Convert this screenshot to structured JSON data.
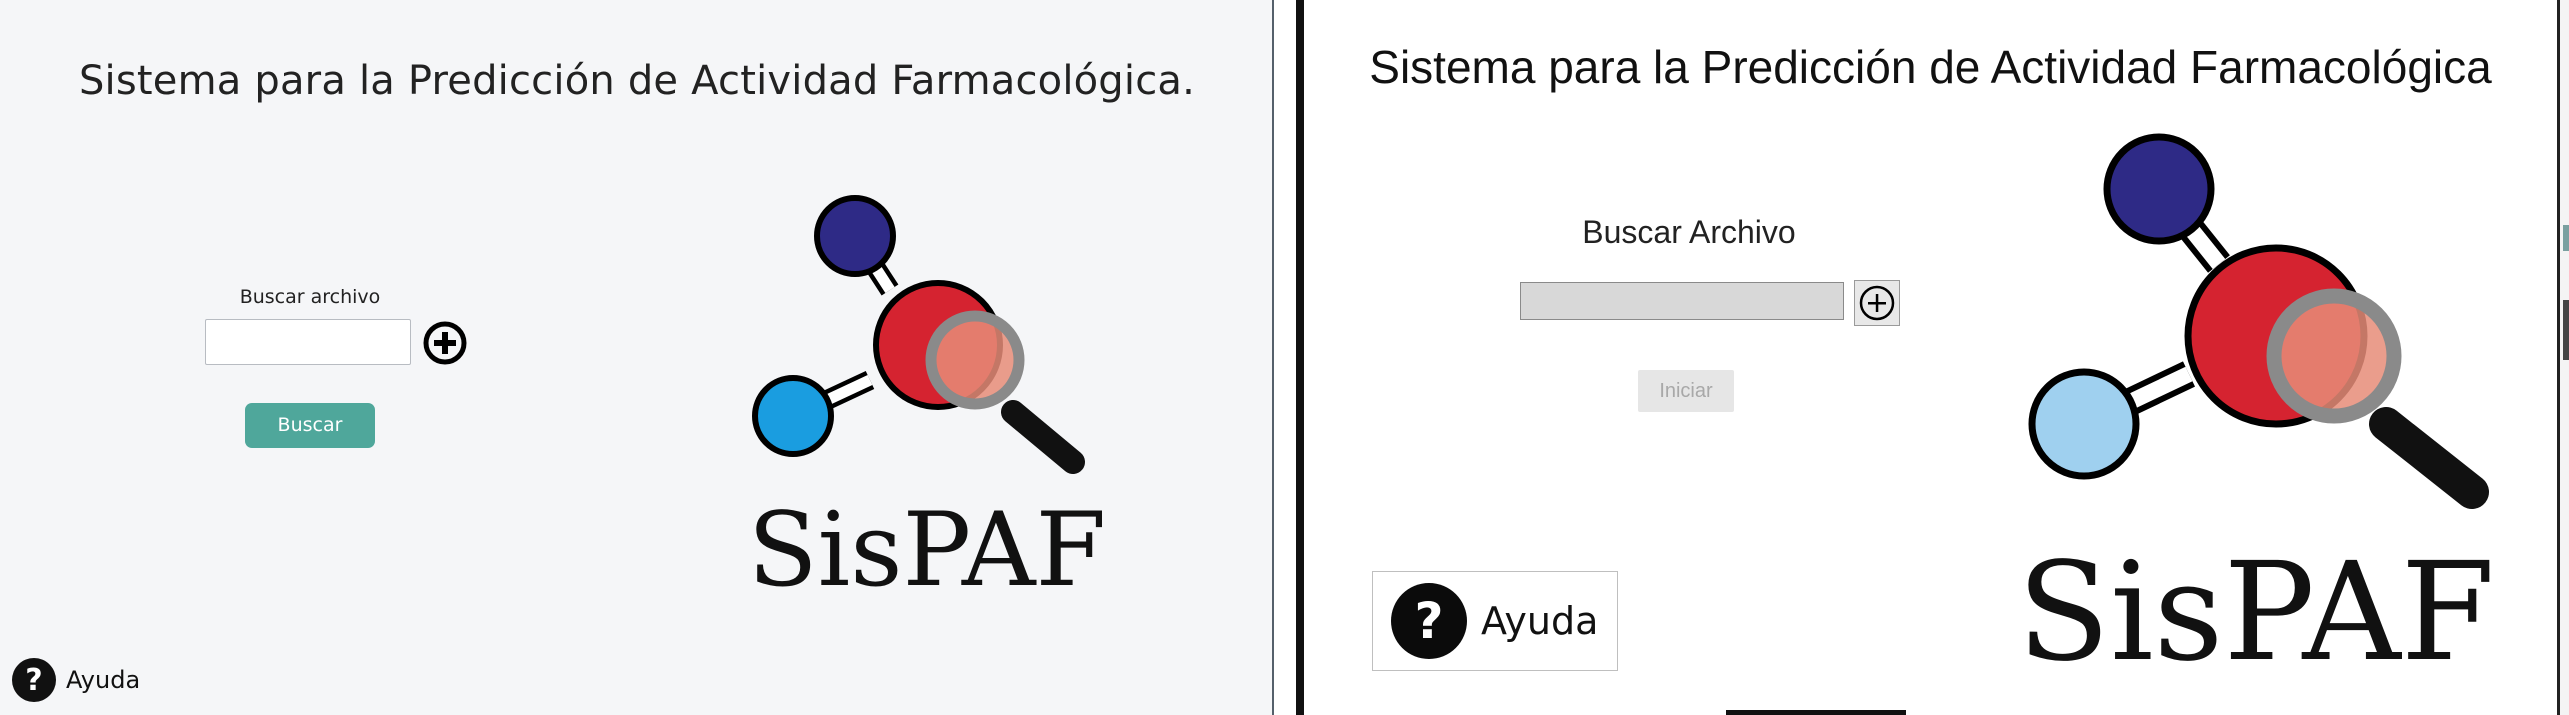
{
  "left_panel": {
    "title": "Sistema para la Predicción de Actividad Farmacológica.",
    "search_label": "Buscar archivo",
    "file_input_value": "",
    "add_icon": "plus-circle-icon",
    "search_button": "Buscar",
    "logo_text": "SisPAF",
    "help_icon": "question-circle-icon",
    "help_label": "Ayuda",
    "colors": {
      "background": "#f5f6f8",
      "button": "#4fa79b"
    }
  },
  "right_panel": {
    "title": "Sistema para la Predicción de Actividad Farmacológica",
    "search_label": "Buscar Archivo",
    "file_input_value": "",
    "add_icon": "plus-circle-icon",
    "start_button": "Iniciar",
    "start_button_state": "disabled",
    "help_icon": "question-circle-icon",
    "help_label": "Ayuda",
    "logo_text": "SisPAF"
  },
  "logo": {
    "atom_colors": {
      "top": "#2e2a86",
      "center": "#d52330",
      "left_left_panel": "#1a9de0",
      "left_right_panel": "#9fd0ef"
    },
    "magnifier_color": "#8a8a8a"
  }
}
